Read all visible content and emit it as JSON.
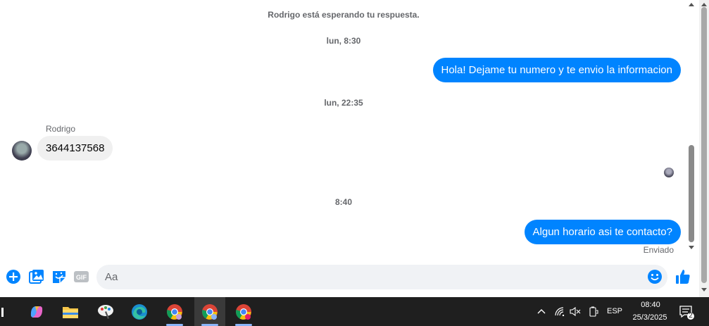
{
  "chat": {
    "waiting_text": "Rodrigo está esperando tu respuesta.",
    "timestamp_1": "lun, 8:30",
    "msg_out_1": "Hola! Dejame tu numero y te envio la informacion",
    "timestamp_2": "lun, 22:35",
    "sender_name": "Rodrigo",
    "msg_in_1": "3644137568",
    "timestamp_3": "8:40",
    "msg_out_2": "Algun horario asi te contacto?",
    "status": "Enviado"
  },
  "composer": {
    "placeholder": "Aa",
    "gif_label": "GIF",
    "accent_color": "#0084ff"
  },
  "taskbar": {
    "language": "ESP",
    "time": "08:40",
    "date": "25/3/2025",
    "notification_count": "2",
    "apps": [
      "copilot-icon",
      "file-explorer-icon",
      "paint-icon",
      "edge-icon",
      "chrome-icon",
      "chrome-icon",
      "chrome-icon"
    ]
  }
}
